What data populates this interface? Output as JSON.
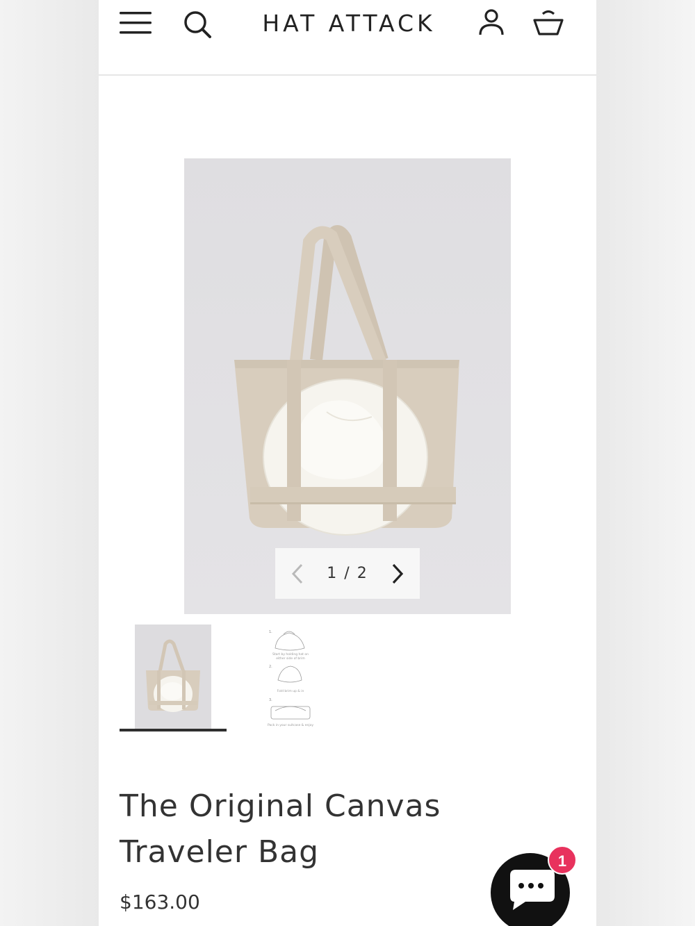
{
  "header": {
    "logo": "HAT ATTACK",
    "icons": [
      "hamburger-menu-icon",
      "search-icon",
      "account-icon",
      "cart-icon"
    ]
  },
  "gallery": {
    "pager_text": "1 / 2",
    "current_index": 1,
    "total": 2,
    "thumbnails": [
      "tote-bag-with-hat-photo",
      "packing-instructions-illustration"
    ],
    "instructions": {
      "step1_num": "1.",
      "step1_text_line1": "Start by holding hat on",
      "step1_text_line2": "either side of brim",
      "step2_num": "2.",
      "step2_text": "Fold brim up & in",
      "step3_num": "3.",
      "step3_text": "Pack in your suitcase & enjoy"
    }
  },
  "product": {
    "title_line1": "The Original Canvas",
    "title_line2": "Traveler Bag",
    "price": "$163.00"
  },
  "chat": {
    "badge_count": "1",
    "icon": "chat-bubble-icon",
    "badge_color": "#e8325d"
  },
  "colors": {
    "canvas": "#d8cdbd",
    "hat": "#f6f4ee",
    "photo_bg": "#e0dfe2"
  }
}
